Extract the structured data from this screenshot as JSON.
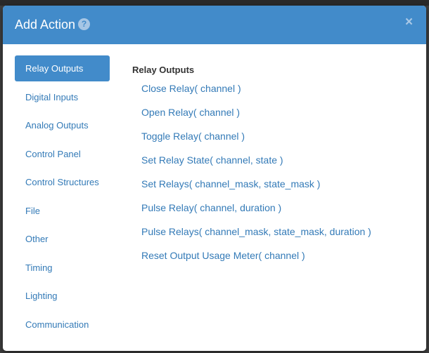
{
  "modal": {
    "title": "Add Action",
    "help_icon": "?",
    "close_icon": "×"
  },
  "sidebar": {
    "items": [
      {
        "label": "Relay Outputs",
        "active": true
      },
      {
        "label": "Digital Inputs"
      },
      {
        "label": "Analog Outputs"
      },
      {
        "label": "Control Panel"
      },
      {
        "label": "Control Structures"
      },
      {
        "label": "File"
      },
      {
        "label": "Other"
      },
      {
        "label": "Timing"
      },
      {
        "label": "Lighting"
      },
      {
        "label": "Communication"
      }
    ]
  },
  "content": {
    "heading": "Relay Outputs",
    "actions": [
      "Close Relay( channel )",
      "Open Relay( channel )",
      "Toggle Relay( channel )",
      "Set Relay State( channel, state )",
      "Set Relays( channel_mask, state_mask )",
      "Pulse Relay( channel, duration )",
      "Pulse Relays( channel_mask, state_mask, duration )",
      "Reset Output Usage Meter( channel )"
    ]
  },
  "colors": {
    "header": "#428bca",
    "link": "#337ab7",
    "active_bg": "#428bca",
    "backdrop": "#3f3f3f"
  },
  "icons": {
    "help": "question-circle-icon",
    "close": "close-icon"
  }
}
